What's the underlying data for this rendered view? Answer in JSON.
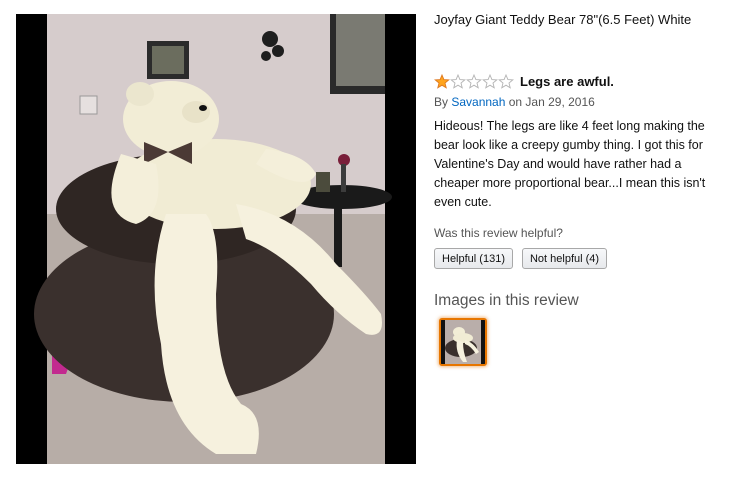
{
  "product": {
    "title": "Joyfay Giant Teddy Bear 78\"(6.5 Feet) White"
  },
  "review": {
    "rating": 1,
    "max_rating": 5,
    "title": "Legs are awful.",
    "by_prefix": "By",
    "author": "Savannah",
    "date_text": "on Jan 29, 2016",
    "body": "Hideous! The legs are like 4 feet long making the bear look like a creepy gumby thing. I got this for Valentine's Day and would have rather had a cheaper more proportional bear...I mean this isn't even cute."
  },
  "helpful": {
    "question": "Was this review helpful?",
    "helpful_label": "Helpful (131)",
    "not_helpful_label": "Not helpful (4)"
  },
  "images_section": {
    "heading": "Images in this review"
  },
  "colors": {
    "star_fill": "#ffa41c",
    "link": "#0066c0",
    "thumb_border": "#e77600"
  }
}
